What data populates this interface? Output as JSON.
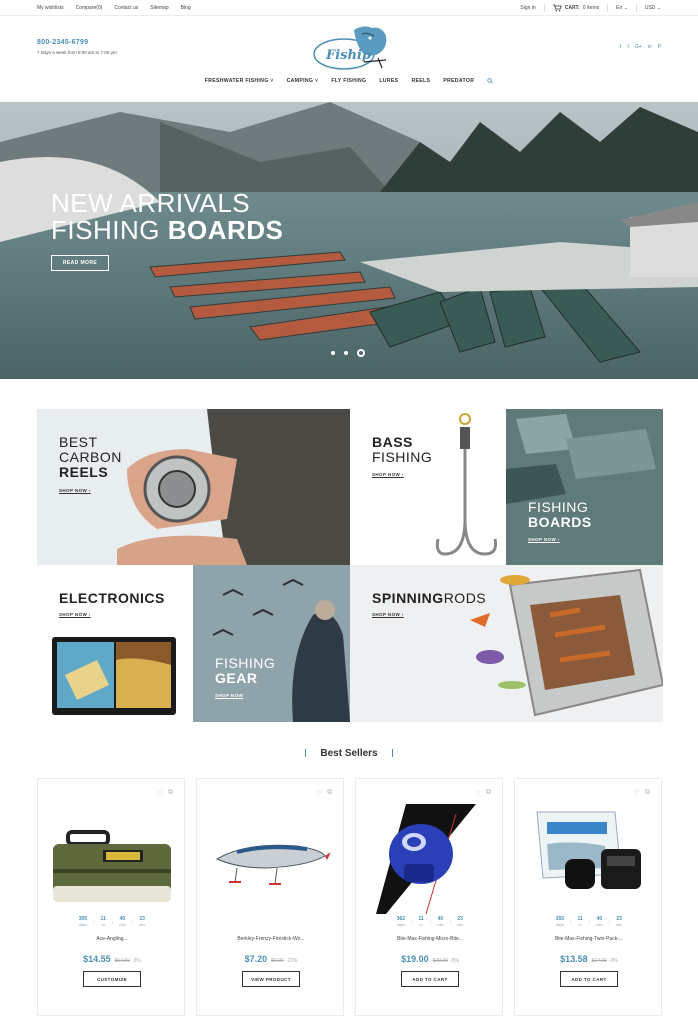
{
  "topbar": {
    "links": [
      "My wishlists",
      "Compare(0)",
      "Contact us",
      "Sitemap",
      "Blog"
    ],
    "sign_in": "Sign in",
    "cart_label": "CART:",
    "cart_value": "0 Items",
    "language": "En",
    "currency": "USD"
  },
  "header": {
    "phone": "800-2345-6799",
    "hours": "7 Days a week from 9:00 am to 7:00 pm",
    "logo_text": "Fiship",
    "social": [
      "f",
      "t",
      "G+",
      "in",
      "P"
    ]
  },
  "nav": {
    "items": [
      "FRESHWATER FISHING",
      "CAMPING",
      "FLY FISHING",
      "LURES",
      "REELS",
      "PREDATOR"
    ]
  },
  "hero": {
    "line1": "NEW ARRIVALS",
    "line2_light": "FISHING",
    "line2_bold": "BOARDS",
    "button": "READ MORE",
    "slide_count": 3,
    "active_slide": 3
  },
  "banners": {
    "carbon": {
      "l1": "BEST",
      "l2": "CARBON",
      "l3": "REELS",
      "shop": "SHOP NOW"
    },
    "bass": {
      "l1": "BASS",
      "l2": "FISHING",
      "shop": "SHOP NOW"
    },
    "boards": {
      "l1": "FISHING",
      "l2": "BOARDS",
      "shop": "SHOP NOW"
    },
    "electronics": {
      "l1": "ELECTRONICS",
      "shop": "SHOP NOW"
    },
    "gear": {
      "l1": "FISHING",
      "l2": "GEAR",
      "shop": "SHOP NOW"
    },
    "spinning": {
      "bold": "SPINNING",
      "light": "RODS",
      "shop": "SHOP NOW"
    }
  },
  "best_sellers": {
    "title": "Best Sellers",
    "countdown_units": [
      "days",
      "hr",
      "min",
      "sec"
    ],
    "products": [
      {
        "name": "Ace-Angling...",
        "price": "$14.55",
        "old_price": "$14.50",
        "discount": "-3%",
        "button": "CUSTOMIZE",
        "days": "305",
        "hr": "11",
        "min": "40",
        "sec": "23"
      },
      {
        "name": "Berkley-Frenzy-Firestick-Wo...",
        "price": "$7.20",
        "old_price": "$9.00",
        "discount": "-22%",
        "button": "VIEW PRODUCT"
      },
      {
        "name": "Bite-Max-Fishing-Micro-Bite...",
        "price": "$19.00",
        "old_price": "$20.00",
        "discount": "-5%",
        "button": "ADD TO CART",
        "days": "362",
        "hr": "11",
        "min": "40",
        "sec": "23"
      },
      {
        "name": "Bite-Max-Fishing-Twin-Pack-...",
        "price": "$13.58",
        "old_price": "$14.00",
        "discount": "-3%",
        "button": "ADD TO CART",
        "days": "355",
        "hr": "11",
        "min": "40",
        "sec": "23"
      }
    ]
  }
}
